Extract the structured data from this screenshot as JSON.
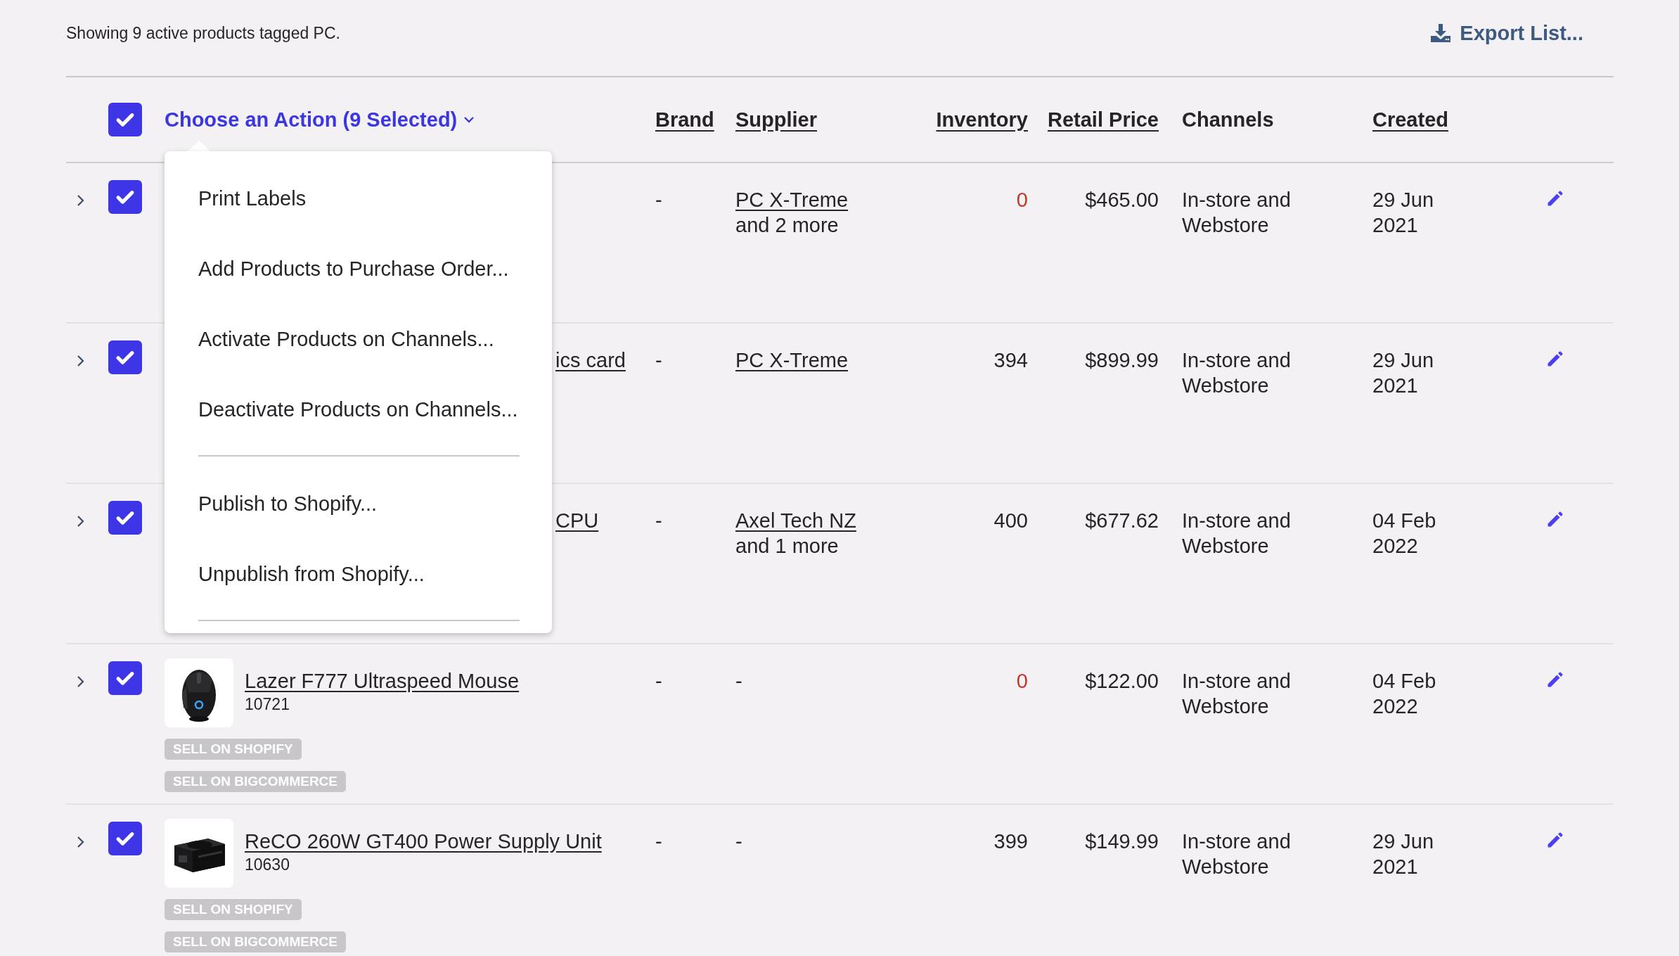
{
  "summary": "Showing 9 active products tagged PC.",
  "export": {
    "label": "Export List..."
  },
  "header": {
    "checked": true,
    "action": {
      "label": "Choose an Action (9 Selected)",
      "expanded": true
    }
  },
  "columns": [
    {
      "label": "Brand",
      "sortable": true
    },
    {
      "label": "Supplier",
      "sortable": true
    },
    {
      "label": "Inventory",
      "sortable": true
    },
    {
      "label": "Retail Price",
      "sortable": true
    },
    {
      "label": "Channels",
      "sortable": false
    },
    {
      "label": "Created",
      "sortable": true
    }
  ],
  "menu": [
    {
      "label": "Print Labels",
      "separator_after": false
    },
    {
      "label": "Add Products to Purchase Order...",
      "separator_after": false
    },
    {
      "label": "Activate Products on Channels...",
      "separator_after": false
    },
    {
      "label": "Deactivate Products on Channels...",
      "separator_after": true
    },
    {
      "label": "Publish to Shopify...",
      "separator_after": false
    },
    {
      "label": "Unpublish from Shopify...",
      "separator_after": true
    }
  ],
  "rows": [
    {
      "kind": "covered",
      "checked": true,
      "brand": "-",
      "supplier": {
        "kind": "link",
        "text": "PC X-Treme",
        "more": "and 2 more"
      },
      "inventory": "0",
      "out_of_stock": true,
      "price": "$465.00",
      "channels": "In-store and Webstore",
      "created": "29 Jun 2021"
    },
    {
      "kind": "covered",
      "checked": true,
      "name": "ics card",
      "brand": "-",
      "supplier": {
        "kind": "link",
        "text": "PC X-Treme"
      },
      "inventory": "394",
      "out_of_stock": false,
      "price": "$899.99",
      "channels": "In-store and Webstore",
      "created": "29 Jun 2021"
    },
    {
      "kind": "covered",
      "checked": true,
      "name": "CPU",
      "brand": "-",
      "supplier": {
        "kind": "link",
        "text": "Axel Tech NZ",
        "more": "and 1 more"
      },
      "inventory": "400",
      "out_of_stock": false,
      "price": "$677.62",
      "channels": "In-store and Webstore",
      "created": "04 Feb 2022"
    },
    {
      "kind": "product",
      "checked": true,
      "name": "Lazer F777 Ultraspeed Mouse",
      "sku": "10721",
      "tags": [
        "SELL ON SHOPIFY",
        "SELL ON BIGCOMMERCE"
      ],
      "brand": "-",
      "supplier": {
        "kind": "plain",
        "text": "-"
      },
      "inventory": "0",
      "out_of_stock": true,
      "price": "$122.00",
      "channels": "In-store and Webstore",
      "created": "04 Feb 2022"
    },
    {
      "kind": "product",
      "checked": true,
      "name": "ReCO 260W GT400 Power Supply Unit",
      "sku": "10630",
      "tags": [
        "SELL ON SHOPIFY",
        "SELL ON BIGCOMMERCE"
      ],
      "brand": "-",
      "supplier": {
        "kind": "plain",
        "text": "-"
      },
      "inventory": "399",
      "out_of_stock": false,
      "price": "$149.99",
      "channels": "In-store and Webstore",
      "created": "29 Jun 2021"
    }
  ]
}
